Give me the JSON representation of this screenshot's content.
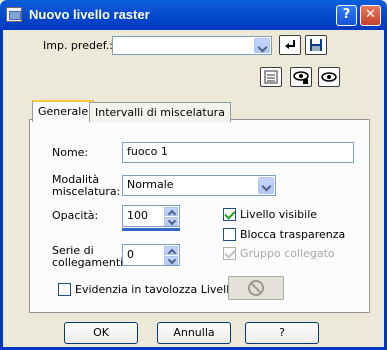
{
  "window": {
    "title": "Nuovo livello raster",
    "help_label": "?",
    "close_label": "✕",
    "title_icon": "raster-layer-icon"
  },
  "preset": {
    "label": "Imp. predef.:",
    "value": "",
    "icons": [
      "apply-preset-icon",
      "save-preset-icon"
    ]
  },
  "toolbar": {
    "icons": [
      "reset-icon",
      "eye-lock-icon",
      "eye-icon"
    ]
  },
  "tabs": [
    {
      "label": "Generale",
      "active": true
    },
    {
      "label": "Intervalli di miscelatura",
      "active": false
    }
  ],
  "general": {
    "name_label": "Nome:",
    "name_value": "fuoco 1",
    "blend_label_1": "Modalità",
    "blend_label_2": "miscelatura:",
    "blend_value": "Normale",
    "opacity_label": "Opacità:",
    "opacity_value": "100",
    "link_label_1": "Serie di",
    "link_label_2": "collegamenti:",
    "link_value": "0",
    "highlight_label": "Evidenzia in tavolozza Livelli",
    "highlight_checked": false,
    "visible_label": "Livello visibile",
    "visible_checked": true,
    "lock_label": "Blocca trasparenza",
    "lock_checked": false,
    "group_label": "Gruppo collegato",
    "group_checked": true,
    "group_disabled": true,
    "no_symbol_icon": "prohibited-icon"
  },
  "buttons": {
    "ok": "OK",
    "cancel": "Annulla",
    "help": "?"
  },
  "colors": {
    "titlebar": "#0346c9",
    "dialog_bg": "#ece9d8",
    "accent": "#316ac5"
  }
}
